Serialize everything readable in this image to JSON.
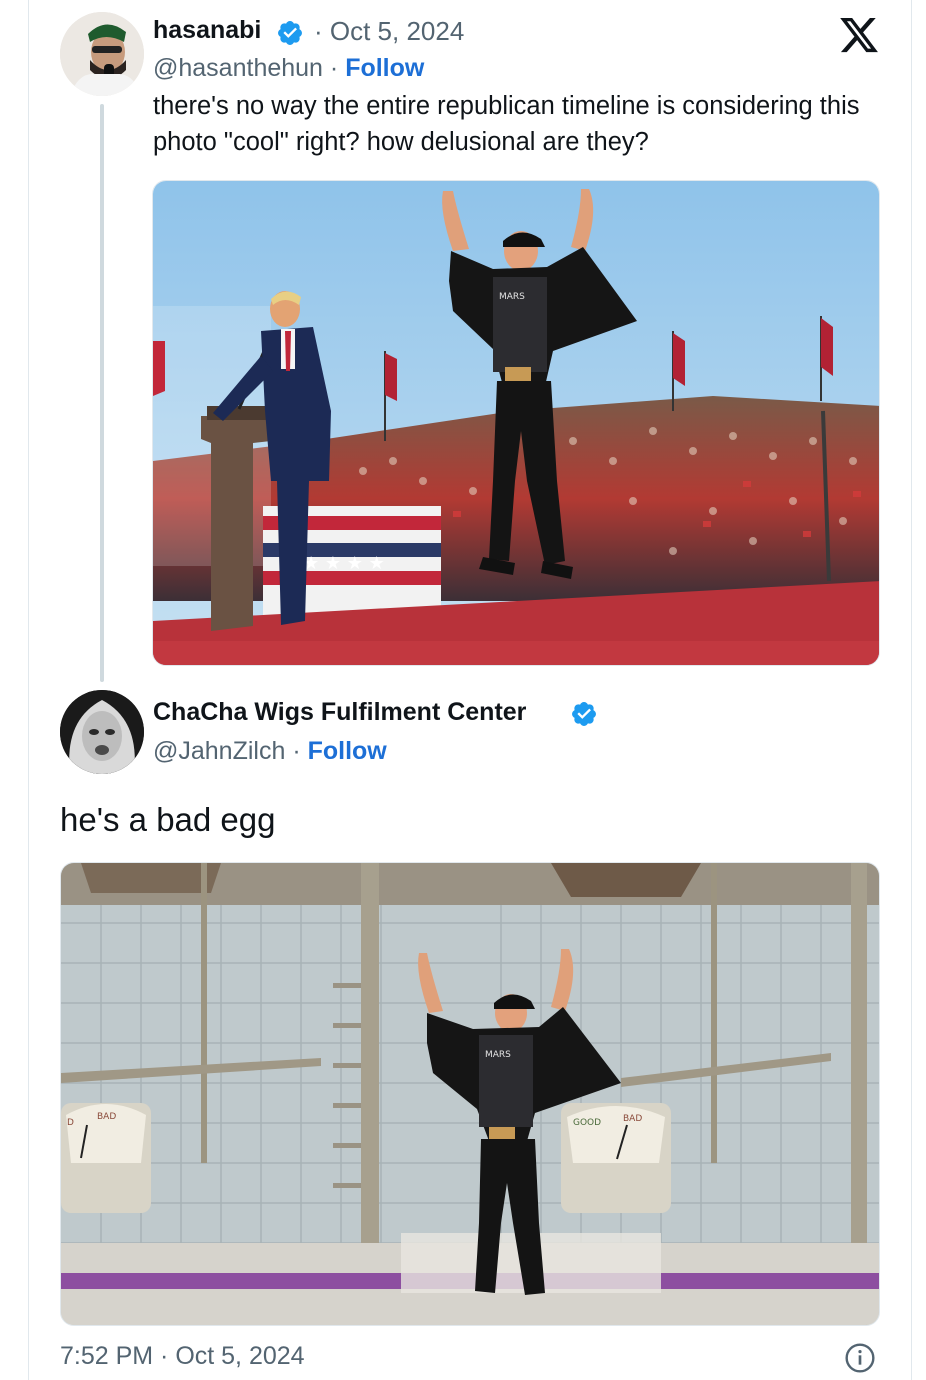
{
  "tweet_original": {
    "display_name": "hasanabi",
    "handle": "@hasanthehun",
    "separator": " · ",
    "follow_label": "Follow",
    "date_prefix": "· ",
    "date": "Oct 5, 2024",
    "text": "there's no way the entire republican timeline is considering this photo \"cool\" right? how delusional are they?",
    "media_icon": "rally-photo"
  },
  "tweet_reply": {
    "display_name": "ChaCha Wigs Fulfilment Center",
    "handle": "@JahnZilch",
    "separator": " · ",
    "follow_label": "Follow",
    "text": "he's a bad egg",
    "media_icon": "egg-sorting-photo",
    "scale_left_labels": [
      "D",
      "BAD"
    ],
    "scale_right_labels": [
      "GOOD",
      "BAD"
    ],
    "shirt_text": "OCCUPY MARS"
  },
  "footer": {
    "timestamp": "7:52 PM · Oct 5, 2024"
  },
  "icons": {
    "brand": "x-logo-icon",
    "verified": "verified-badge-icon",
    "info": "info-icon"
  },
  "colors": {
    "link_blue": "#1d6fd6",
    "verified_blue": "#1d9bf0",
    "muted_gray": "#536471",
    "text_black": "#0f1419"
  }
}
